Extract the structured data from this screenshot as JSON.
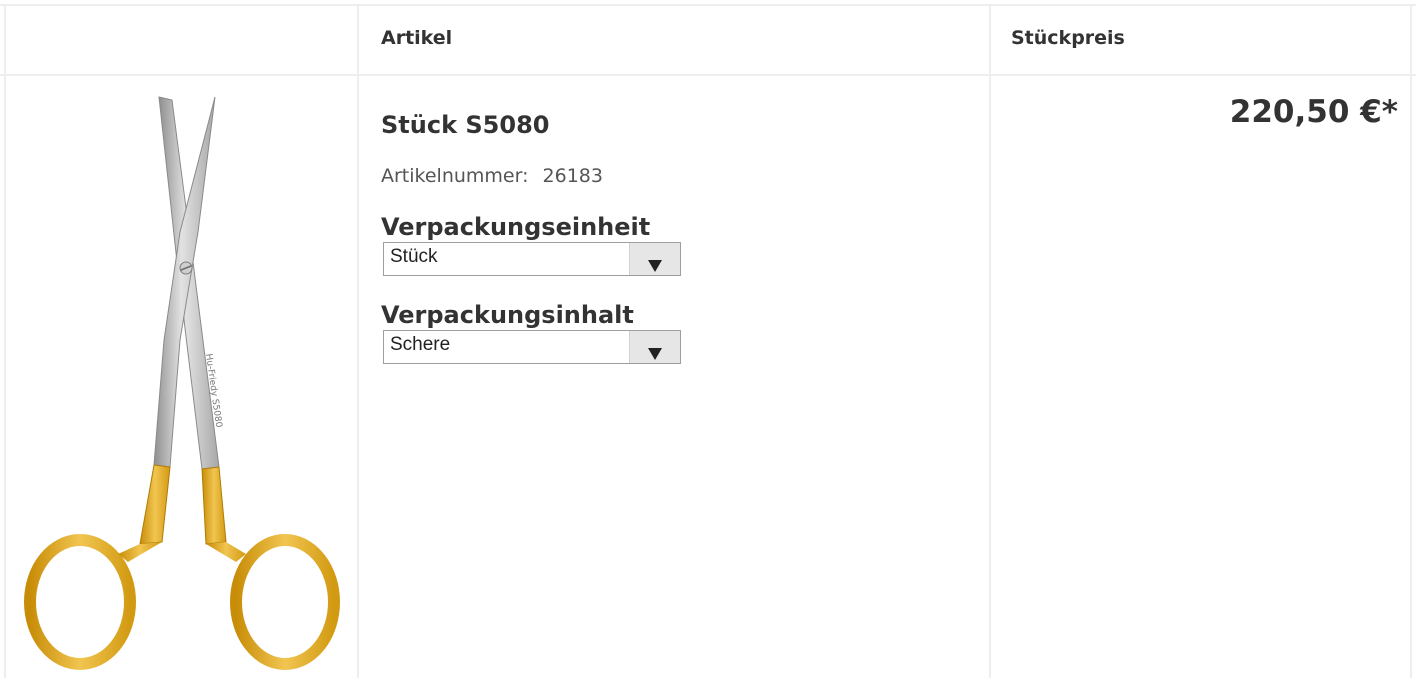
{
  "table": {
    "header": {
      "article": "Artikel",
      "unit_price": "Stückpreis"
    },
    "row": {
      "image_alt": "Schere S5080",
      "image_engraving": "Hu-Friedy S5080",
      "title": "Stück S5080",
      "article_number_label": "Artikelnummer:",
      "article_number": "26183",
      "packaging_unit_label": "Verpackungseinheit",
      "packaging_unit_value": "Stück",
      "packaging_content_label": "Verpackungsinhalt",
      "packaging_content_value": "Schere",
      "price": "220,50 €*"
    }
  },
  "colors": {
    "grid": "#eeeeee",
    "text": "#333333",
    "gold": "#e3a91c",
    "steel": "#b8b8b8"
  }
}
